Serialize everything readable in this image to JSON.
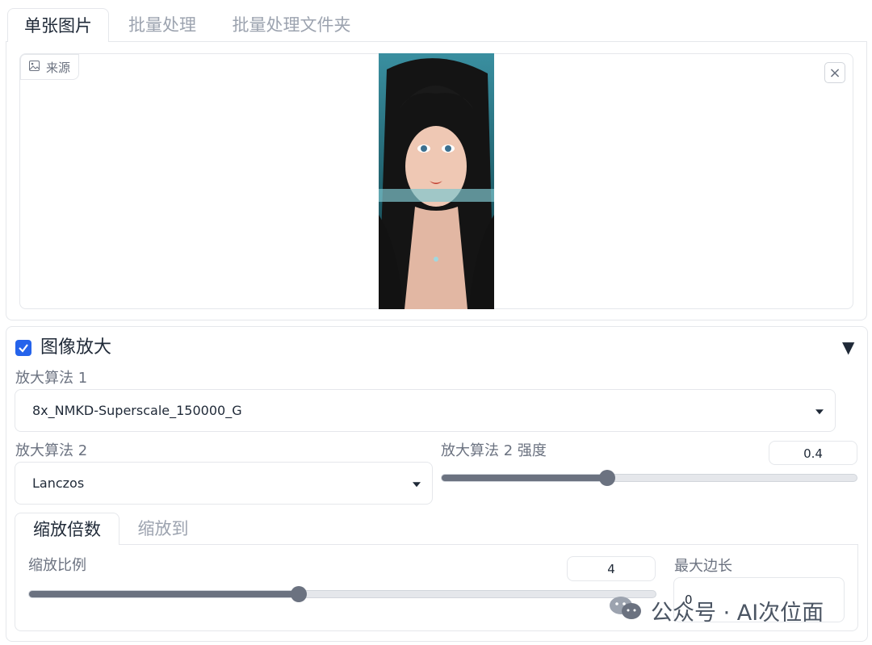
{
  "tabs": [
    {
      "label": "单张图片",
      "active": true
    },
    {
      "label": "批量处理",
      "active": false
    },
    {
      "label": "批量处理文件夹",
      "active": false
    }
  ],
  "source": {
    "label": "来源",
    "icon": "image-icon",
    "close_icon": "close-icon"
  },
  "upscale": {
    "enabled": true,
    "title": "图像放大",
    "collapse_icon": "triangle-down-icon",
    "upscaler1": {
      "label": "放大算法 1",
      "value": "8x_NMKD-Superscale_150000_G"
    },
    "upscaler2": {
      "label": "放大算法 2",
      "value": "Lanczos"
    },
    "upscaler2_strength": {
      "label": "放大算法 2 强度",
      "value": "0.4",
      "min": 0,
      "max": 1,
      "fraction": 0.4
    },
    "subtabs": [
      {
        "label": "缩放倍数",
        "active": true
      },
      {
        "label": "缩放到",
        "active": false
      }
    ],
    "scale_ratio": {
      "label": "缩放比例",
      "value": "4",
      "min": 1,
      "max": 8,
      "fraction": 0.43
    },
    "max_side": {
      "label": "最大边长",
      "value": "0"
    }
  },
  "watermark": {
    "text": "公众号 · AI次位面",
    "icon": "wechat-icon"
  },
  "colors": {
    "accent": "#2563eb",
    "slider": "#6b7280",
    "border": "#e5e7eb"
  }
}
